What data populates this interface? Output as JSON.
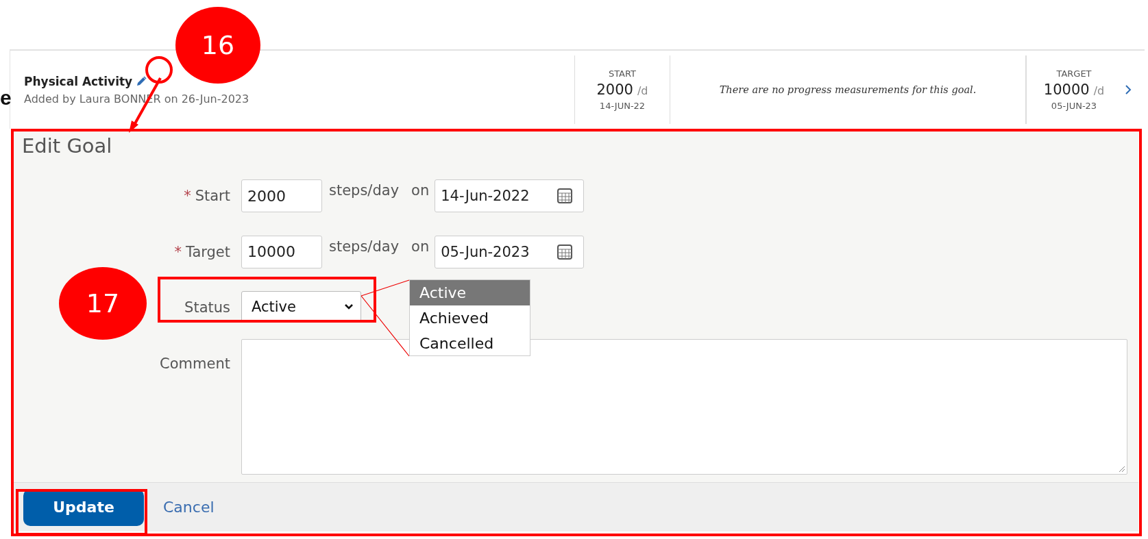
{
  "edge_text": "e",
  "goal": {
    "title": "Physical Activity",
    "added_by": "Added by Laura BONNER on 26-Jun-2023",
    "start": {
      "label": "START",
      "value": "2000",
      "unit": "/d",
      "date": "14-JUN-22"
    },
    "message": "There are no progress measurements for this goal.",
    "target": {
      "label": "TARGET",
      "value": "10000",
      "unit": "/d",
      "date": "05-JUN-23"
    }
  },
  "edit_goal": {
    "title": "Edit Goal",
    "rows": [
      {
        "kind": "measure",
        "required_mark": "*",
        "label": "Start",
        "value": "2000",
        "unit": "steps/day",
        "on": "on",
        "date": "14-Jun-2022"
      },
      {
        "kind": "measure",
        "required_mark": "*",
        "label": "Target",
        "value": "10000",
        "unit": "steps/day",
        "on": "on",
        "date": "05-Jun-2023"
      },
      {
        "kind": "select",
        "label": "Status",
        "value": "Active"
      },
      {
        "kind": "textarea",
        "label": "Comment"
      }
    ],
    "status_options": [
      {
        "label": "Active",
        "selected": true
      },
      {
        "label": "Achieved",
        "selected": false
      },
      {
        "label": "Cancelled",
        "selected": false
      }
    ],
    "buttons": {
      "update": "Update",
      "cancel": "Cancel"
    }
  },
  "annotations": [
    {
      "label": "16"
    },
    {
      "label": "17"
    }
  ]
}
